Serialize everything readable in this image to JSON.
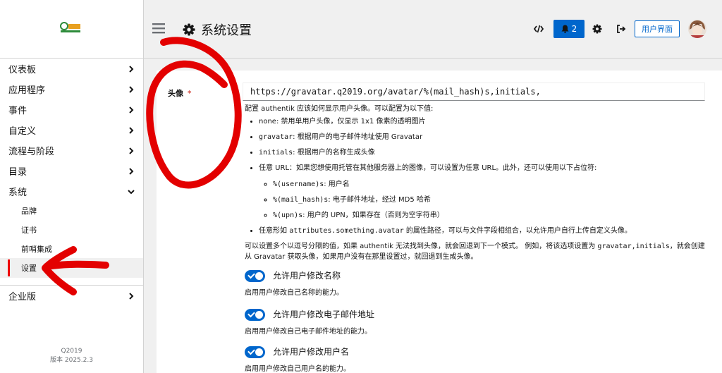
{
  "sidebar": {
    "logo_text": "Q2019",
    "items": [
      {
        "label": "仪表板"
      },
      {
        "label": "应用程序"
      },
      {
        "label": "事件"
      },
      {
        "label": "自定义"
      },
      {
        "label": "流程与阶段"
      },
      {
        "label": "目录"
      },
      {
        "label": "系统"
      },
      {
        "label": "企业版"
      }
    ],
    "system_children": [
      {
        "label": "品牌"
      },
      {
        "label": "证书"
      },
      {
        "label": "前哨集成"
      },
      {
        "label": "设置"
      }
    ],
    "footer_brand": "Q2019",
    "footer_version": "版本 2025.2.3"
  },
  "header": {
    "title": "系统设置",
    "notification_count": "2",
    "user_interface_label": "用户界面"
  },
  "form": {
    "avatar_label": "头像",
    "required_mark": "*",
    "avatar_value": "https://gravatar.q2019.org/avatar/%(mail_hash)s,initials,",
    "help": {
      "intro": "配置 authentik 应该如何显示用户头像。可以配置为以下值:",
      "opt_none": "none: 禁用单用户头像，仅显示 1x1 像素的透明图片",
      "opt_gravatar_code": "gravatar",
      "opt_gravatar_text": ": 根据用户的电子邮件地址使用 Gravatar",
      "opt_initials_code": "initials",
      "opt_initials_text": ": 根据用户的名称生成头像",
      "opt_url": "任意 URL：如果您想使用托管在其他服务器上的图像，可以设置为任意 URL。此外，还可以使用以下占位符:",
      "ph_username_code": "%(username)s",
      "ph_username_text": ": 用户名",
      "ph_mail_code": "%(mail_hash)s",
      "ph_mail_text": ": 电子邮件地址，经过 MD5 哈希",
      "ph_upn_code": "%(upn)s",
      "ph_upn_text": ": 用户的 UPN，如果存在（否则为空字符串）",
      "opt_attr_pre": "任意形如 ",
      "opt_attr_code": "attributes.something.avatar",
      "opt_attr_post": " 的属性路径，可以与文件字段相组合，以允许用户自行上传自定义头像。",
      "multi_pre": "可以设置多个以逗号分隔的值，如果 authentik 无法找到头像，就会回退到下一个模式。 例如，将该选项设置为 ",
      "multi_code": "gravatar,initials",
      "multi_post": "，就会创建从 Gravatar 获取头像，如果用户没有在那里设置过，就回退到生成头像。"
    },
    "toggles": [
      {
        "label": "允许用户修改名称",
        "help": "启用用户修改自己名称的能力。",
        "enabled": true
      },
      {
        "label": "允许用户修改电子邮件地址",
        "help": "启用用户修改自己电子邮件地址的能力。",
        "enabled": true
      },
      {
        "label": "允许用户修改用户名",
        "help": "启用用户修改自己用户名的能力。",
        "enabled": true
      }
    ]
  },
  "colors": {
    "accent": "#0066cc",
    "active_marker": "#ee0000",
    "annotation": "#e30000"
  }
}
